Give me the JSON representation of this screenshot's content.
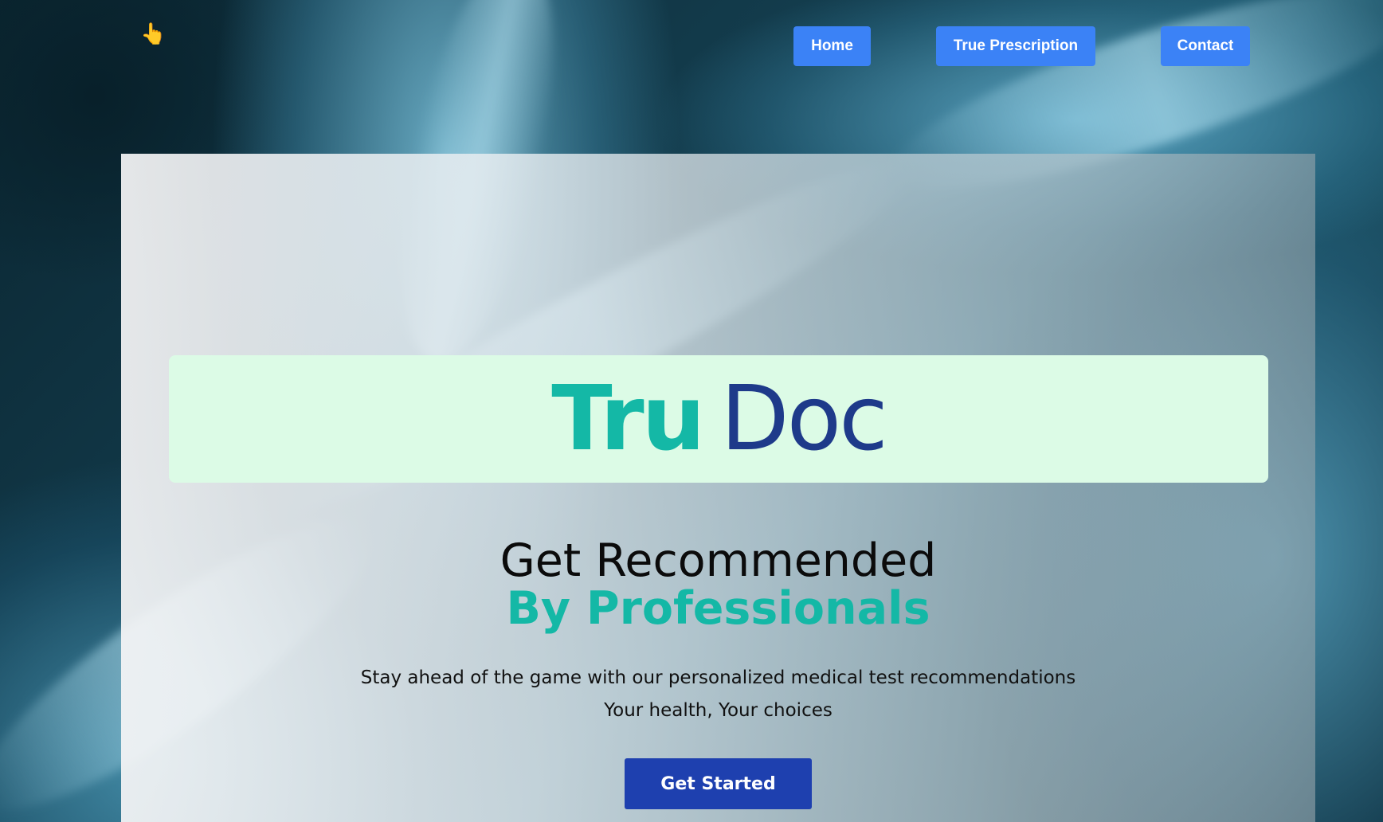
{
  "nav": {
    "home_label": "Home",
    "prescription_label": "True Prescription",
    "contact_label": "Contact"
  },
  "hero": {
    "logo_part1": "Tru",
    "logo_part2": "Doc",
    "headline_line1": "Get Recommended",
    "headline_line2": "By Professionals",
    "tagline_line1": "Stay ahead of the game with our personalized medical test recommendations",
    "tagline_line2": "Your health, Your choices",
    "cta_label": "Get Started"
  },
  "colors": {
    "nav_button": "#3b82f6",
    "logo_teal": "#14b8a6",
    "logo_navy": "#1e3a8a",
    "logo_box": "#dcfbe6",
    "cta": "#1e40af"
  },
  "icons": {
    "nav_icon": "pointing-hand-icon"
  }
}
